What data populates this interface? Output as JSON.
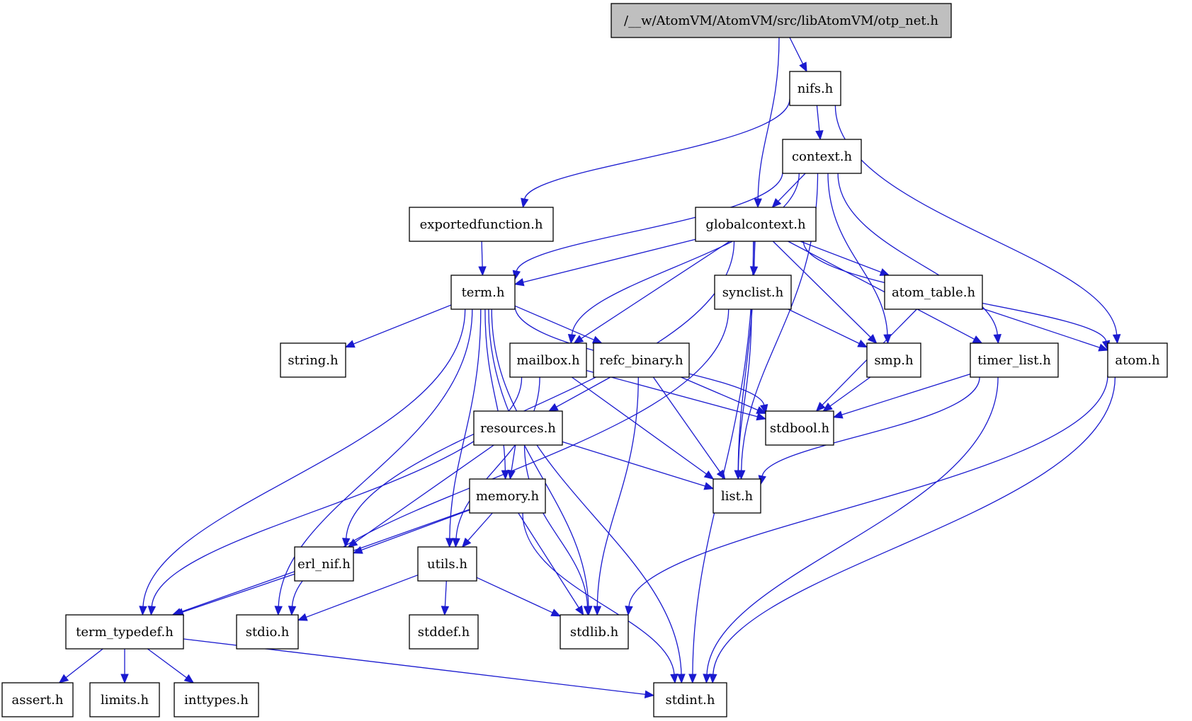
{
  "graph": {
    "title": "/__w/AtomVM/AtomVM/src/libAtomVM/otp_net.h",
    "colors": {
      "edge": "#1a1acf",
      "root_fill": "#bfbfbf",
      "node_fill": "#ffffff",
      "border": "#000000"
    },
    "nodes": [
      {
        "id": "otp_net",
        "label": "/__w/AtomVM/AtomVM/src/libAtomVM/otp_net.h",
        "root": true
      },
      {
        "id": "nifs",
        "label": "nifs.h"
      },
      {
        "id": "context",
        "label": "context.h"
      },
      {
        "id": "exportedfunction",
        "label": "exportedfunction.h"
      },
      {
        "id": "globalcontext",
        "label": "globalcontext.h"
      },
      {
        "id": "term",
        "label": "term.h"
      },
      {
        "id": "synclist",
        "label": "synclist.h"
      },
      {
        "id": "atom_table",
        "label": "atom_table.h"
      },
      {
        "id": "string",
        "label": "string.h"
      },
      {
        "id": "mailbox",
        "label": "mailbox.h"
      },
      {
        "id": "refc_binary",
        "label": "refc_binary.h"
      },
      {
        "id": "smp",
        "label": "smp.h"
      },
      {
        "id": "timer_list",
        "label": "timer_list.h"
      },
      {
        "id": "atom",
        "label": "atom.h"
      },
      {
        "id": "resources",
        "label": "resources.h"
      },
      {
        "id": "stdbool",
        "label": "stdbool.h"
      },
      {
        "id": "memory",
        "label": "memory.h"
      },
      {
        "id": "list",
        "label": "list.h"
      },
      {
        "id": "erl_nif",
        "label": "erl_nif.h"
      },
      {
        "id": "utils",
        "label": "utils.h"
      },
      {
        "id": "term_typedef",
        "label": "term_typedef.h"
      },
      {
        "id": "stdio",
        "label": "stdio.h"
      },
      {
        "id": "stddef",
        "label": "stddef.h"
      },
      {
        "id": "stdlib",
        "label": "stdlib.h"
      },
      {
        "id": "assert",
        "label": "assert.h"
      },
      {
        "id": "limits",
        "label": "limits.h"
      },
      {
        "id": "inttypes",
        "label": "inttypes.h"
      },
      {
        "id": "stdint",
        "label": "stdint.h"
      }
    ],
    "edges": [
      [
        "otp_net",
        "nifs"
      ],
      [
        "otp_net",
        "globalcontext"
      ],
      [
        "nifs",
        "context"
      ],
      [
        "nifs",
        "exportedfunction"
      ],
      [
        "nifs",
        "atom"
      ],
      [
        "context",
        "globalcontext"
      ],
      [
        "context",
        "term"
      ],
      [
        "context",
        "mailbox"
      ],
      [
        "context",
        "smp"
      ],
      [
        "context",
        "timer_list"
      ],
      [
        "context",
        "list"
      ],
      [
        "exportedfunction",
        "term"
      ],
      [
        "globalcontext",
        "term"
      ],
      [
        "globalcontext",
        "synclist"
      ],
      [
        "globalcontext",
        "atom_table"
      ],
      [
        "globalcontext",
        "mailbox"
      ],
      [
        "globalcontext",
        "smp"
      ],
      [
        "globalcontext",
        "timer_list"
      ],
      [
        "globalcontext",
        "atom"
      ],
      [
        "globalcontext",
        "list"
      ],
      [
        "globalcontext",
        "erl_nif"
      ],
      [
        "globalcontext",
        "stdint"
      ],
      [
        "term",
        "string"
      ],
      [
        "term",
        "refc_binary"
      ],
      [
        "term",
        "memory"
      ],
      [
        "term",
        "utils"
      ],
      [
        "term",
        "term_typedef"
      ],
      [
        "term",
        "stdio"
      ],
      [
        "term",
        "stdlib"
      ],
      [
        "term",
        "stdbool"
      ],
      [
        "term",
        "stdint"
      ],
      [
        "synclist",
        "smp"
      ],
      [
        "synclist",
        "list"
      ],
      [
        "synclist",
        "stdio"
      ],
      [
        "atom_table",
        "atom"
      ],
      [
        "atom_table",
        "stdbool"
      ],
      [
        "mailbox",
        "stdbool"
      ],
      [
        "mailbox",
        "list"
      ],
      [
        "mailbox",
        "utils"
      ],
      [
        "mailbox",
        "term_typedef"
      ],
      [
        "refc_binary",
        "resources"
      ],
      [
        "refc_binary",
        "stdbool"
      ],
      [
        "refc_binary",
        "list"
      ],
      [
        "refc_binary",
        "stdlib"
      ],
      [
        "smp",
        "stdbool"
      ],
      [
        "timer_list",
        "stdbool"
      ],
      [
        "timer_list",
        "list"
      ],
      [
        "timer_list",
        "stdint"
      ],
      [
        "atom",
        "stdlib"
      ],
      [
        "atom",
        "stdint"
      ],
      [
        "resources",
        "memory"
      ],
      [
        "resources",
        "list"
      ],
      [
        "resources",
        "erl_nif"
      ],
      [
        "resources",
        "stdlib"
      ],
      [
        "memory",
        "utils"
      ],
      [
        "memory",
        "erl_nif"
      ],
      [
        "memory",
        "term_typedef"
      ],
      [
        "memory",
        "stdlib"
      ],
      [
        "memory",
        "stdint"
      ],
      [
        "erl_nif",
        "term_typedef"
      ],
      [
        "utils",
        "stdio"
      ],
      [
        "utils",
        "stddef"
      ],
      [
        "utils",
        "stdlib"
      ],
      [
        "term_typedef",
        "assert"
      ],
      [
        "term_typedef",
        "limits"
      ],
      [
        "term_typedef",
        "inttypes"
      ],
      [
        "term_typedef",
        "stdint"
      ]
    ]
  }
}
